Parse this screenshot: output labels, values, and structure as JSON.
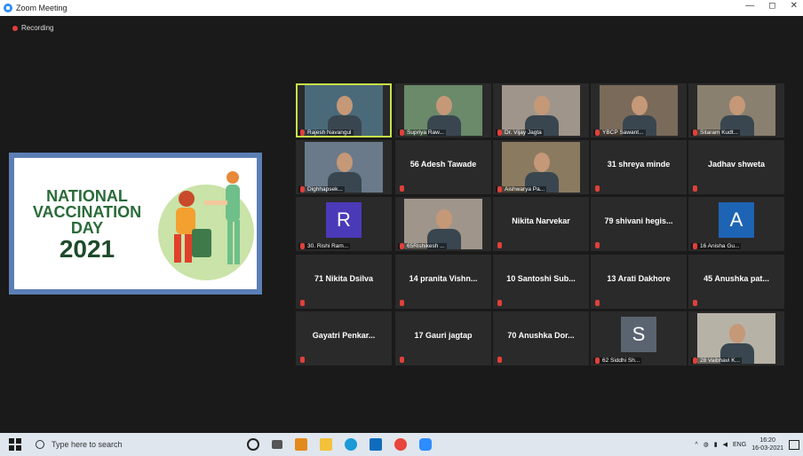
{
  "window": {
    "title": "Zoom Meeting",
    "controls": [
      "—",
      "◻",
      "✕"
    ]
  },
  "recording": {
    "label": "Recording"
  },
  "shared_screen": {
    "line1": "NATIONAL",
    "line2": "VACCINATION",
    "line3": "DAY",
    "year": "2021"
  },
  "participants": [
    {
      "label": "Rajesh Navangul",
      "type": "video",
      "active": true
    },
    {
      "label": "Supriya Raw...",
      "type": "video"
    },
    {
      "label": "Dr. Vijay Jagta",
      "type": "video"
    },
    {
      "label": "YBCP Sawant...",
      "type": "video"
    },
    {
      "label": "Sitaram Kudt...",
      "type": "video"
    },
    {
      "label": "Dighhapsek...",
      "type": "video"
    },
    {
      "center": "56 Adesh Tawade",
      "type": "name"
    },
    {
      "label": "Aishwarya Pa...",
      "type": "video"
    },
    {
      "center": "31 shreya minde",
      "type": "name"
    },
    {
      "center": "Jadhav shweta",
      "type": "name"
    },
    {
      "label": "30. Rishi Ram...",
      "type": "avatar",
      "letter": "R",
      "color": "#4a3ab8"
    },
    {
      "label": "65Rishikesh ...",
      "type": "video"
    },
    {
      "center": "Nikita Narvekar",
      "type": "name"
    },
    {
      "center": "79 shivani hegis...",
      "type": "name"
    },
    {
      "label": "16 Anisha Gu...",
      "type": "avatar",
      "letter": "A",
      "color": "#1e64b4"
    },
    {
      "center": "71 Nikita Dsilva",
      "type": "name"
    },
    {
      "center": "14 pranita Vishn...",
      "type": "name"
    },
    {
      "center": "10 Santoshi Sub...",
      "type": "name"
    },
    {
      "center": "13 Arati Dakhore",
      "type": "name"
    },
    {
      "center": "45 Anushka pat...",
      "type": "name"
    },
    {
      "center": "Gayatri Penkar...",
      "type": "name"
    },
    {
      "center": "17 Gauri jagtap",
      "type": "name"
    },
    {
      "center": "70 Anushka Dor...",
      "type": "name"
    },
    {
      "label": "62 Siddhi Sh...",
      "type": "avatar",
      "letter": "S",
      "color": "#5a6470"
    },
    {
      "label": "28 Vaibhavi K...",
      "type": "video"
    }
  ],
  "taskbar": {
    "search_placeholder": "Type here to search",
    "lang": "ENG",
    "time": "16:20",
    "date": "16-03-2021"
  }
}
